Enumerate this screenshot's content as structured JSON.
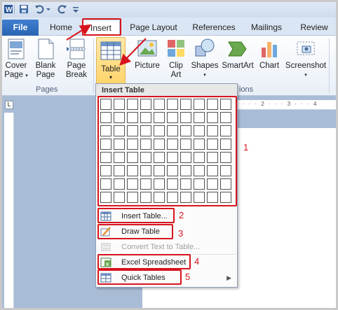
{
  "tabs": [
    {
      "label": "File"
    },
    {
      "label": "Home"
    },
    {
      "label": "Insert"
    },
    {
      "label": "Page Layout"
    },
    {
      "label": "References"
    },
    {
      "label": "Mailings"
    },
    {
      "label": "Review"
    }
  ],
  "ribbon": {
    "cover_page": {
      "line1": "Cover",
      "line2": "Page"
    },
    "blank_page": {
      "line1": "Blank",
      "line2": "Page"
    },
    "page_break": {
      "line1": "Page",
      "line2": "Break"
    },
    "pages_group": "Pages",
    "table": "Table",
    "picture": "Picture",
    "clip_art": {
      "line1": "Clip",
      "line2": "Art"
    },
    "shapes": "Shapes",
    "smartart": "SmartArt",
    "chart": "Chart",
    "screenshot": "Screenshot",
    "illustrations_group_partial": "ions"
  },
  "ruler": {
    "corner": "L",
    "marks": "1 · · · 2 · · · 3 · · · 4"
  },
  "dropdown": {
    "header": "Insert Table",
    "grid": {
      "columns": 10,
      "rows": 8
    },
    "items": [
      {
        "label": "Insert Table...",
        "enabled": true
      },
      {
        "label": "Draw Table",
        "enabled": true
      },
      {
        "label": "Convert Text to Table...",
        "enabled": false
      },
      {
        "label": "Excel Spreadsheet",
        "enabled": true
      },
      {
        "label": "Quick Tables",
        "enabled": true,
        "submenu": true
      }
    ]
  },
  "annotations": [
    "1",
    "2",
    "3",
    "4",
    "5"
  ],
  "colors": {
    "annotation": "#d7141e",
    "file_tab": "#2a64b3",
    "selected_button": "#ffd46b"
  }
}
